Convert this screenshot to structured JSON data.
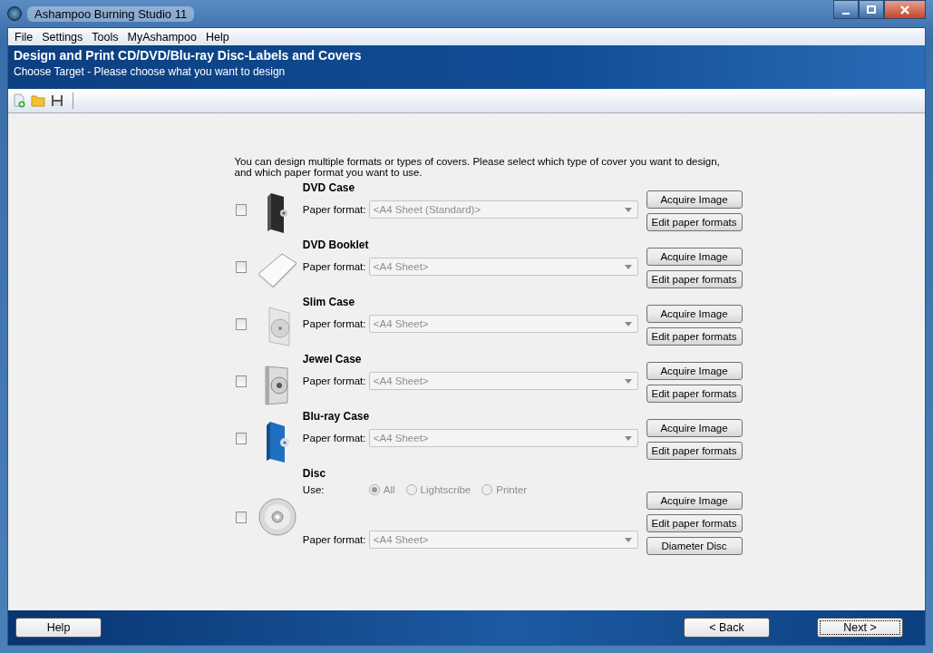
{
  "window": {
    "title": "Ashampoo Burning Studio 11"
  },
  "menu": [
    {
      "label": "File"
    },
    {
      "label": "Settings"
    },
    {
      "label": "Tools"
    },
    {
      "label": "MyAshampoo"
    },
    {
      "label": "Help"
    }
  ],
  "header": {
    "title": "Design and Print CD/DVD/Blu-ray Disc-Labels and Covers",
    "subtitle": "Choose Target - Please choose what you want to design"
  },
  "intro": "You can design multiple formats or types of covers. Please select which type of cover you want to design, and which paper format you want to use.",
  "items": [
    {
      "kind": "case",
      "title": "DVD Case",
      "checked": false,
      "paper_label": "Paper format:",
      "paper_format": "<A4 Sheet (Standard)>",
      "disabled": true,
      "buttons": [
        "Acquire Image",
        "Edit paper formats"
      ]
    },
    {
      "kind": "booklet",
      "title": "DVD Booklet",
      "checked": false,
      "paper_label": "Paper format:",
      "paper_format": "<A4 Sheet>",
      "disabled": true,
      "buttons": [
        "Acquire Image",
        "Edit paper formats"
      ]
    },
    {
      "kind": "slim",
      "title": "Slim Case",
      "checked": false,
      "paper_label": "Paper format:",
      "paper_format": "<A4 Sheet>",
      "disabled": true,
      "buttons": [
        "Acquire Image",
        "Edit paper formats"
      ]
    },
    {
      "kind": "jewel",
      "title": "Jewel Case",
      "checked": false,
      "paper_label": "Paper format:",
      "paper_format": "<A4 Sheet>",
      "disabled": true,
      "buttons": [
        "Acquire Image",
        "Edit paper formats"
      ]
    },
    {
      "kind": "bluray",
      "title": "Blu-ray Case",
      "checked": false,
      "paper_label": "Paper format:",
      "paper_format": "<A4 Sheet>",
      "disabled": true,
      "buttons": [
        "Acquire Image",
        "Edit paper formats"
      ]
    },
    {
      "kind": "disc",
      "title": "Disc",
      "checked": false,
      "use_label": "Use:",
      "options": [
        {
          "label": "All",
          "selected": true,
          "disabled": true
        },
        {
          "label": "Lightscribe",
          "selected": false,
          "disabled": true
        },
        {
          "label": "Printer",
          "selected": false,
          "disabled": true
        }
      ],
      "paper_label": "Paper format:",
      "paper_format": "<A4 Sheet>",
      "disabled": true,
      "buttons": [
        "Acquire Image",
        "Edit paper formats",
        "Diameter Disc"
      ]
    }
  ],
  "footer": {
    "help": "Help",
    "back": "< Back",
    "next": "Next >"
  }
}
